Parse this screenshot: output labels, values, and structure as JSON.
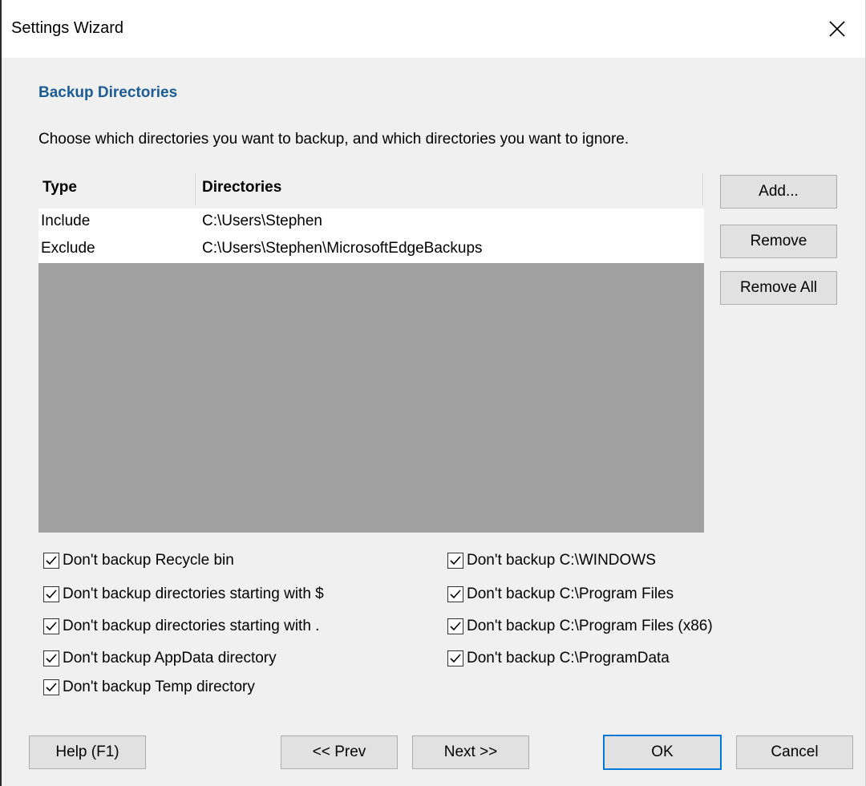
{
  "window": {
    "title": "Settings Wizard"
  },
  "section": {
    "title": "Backup Directories",
    "description": "Choose which directories you want to backup, and which directories you want to ignore."
  },
  "list": {
    "headers": {
      "type": "Type",
      "directories": "Directories"
    },
    "rows": [
      {
        "type": "Include",
        "directory": "C:\\Users\\Stephen"
      },
      {
        "type": "Exclude",
        "directory": "C:\\Users\\Stephen\\MicrosoftEdgeBackups"
      }
    ]
  },
  "side_buttons": {
    "add": "Add...",
    "remove": "Remove",
    "remove_all": "Remove All"
  },
  "options_left": [
    {
      "label": "Don't backup Recycle bin",
      "checked": true
    },
    {
      "label": "Don't backup directories starting with $",
      "checked": true
    },
    {
      "label": "Don't backup directories starting with .",
      "checked": true
    },
    {
      "label": "Don't backup AppData directory",
      "checked": true
    },
    {
      "label": "Don't backup Temp directory",
      "checked": true
    }
  ],
  "options_right": [
    {
      "label": "Don't backup C:\\WINDOWS",
      "checked": true
    },
    {
      "label": "Don't backup C:\\Program Files",
      "checked": true
    },
    {
      "label": "Don't backup C:\\Program Files (x86)",
      "checked": true
    },
    {
      "label": "Don't backup C:\\ProgramData",
      "checked": true
    }
  ],
  "footer": {
    "help": "Help (F1)",
    "prev": "<< Prev",
    "next": "Next >>",
    "ok": "OK",
    "cancel": "Cancel"
  },
  "colors": {
    "section_title": "#1a5c93",
    "list_empty": "#a0a0a0",
    "default_button_border": "#0078d7"
  },
  "icons": {
    "close": "close-icon",
    "checkbox": "checkmark-icon"
  }
}
